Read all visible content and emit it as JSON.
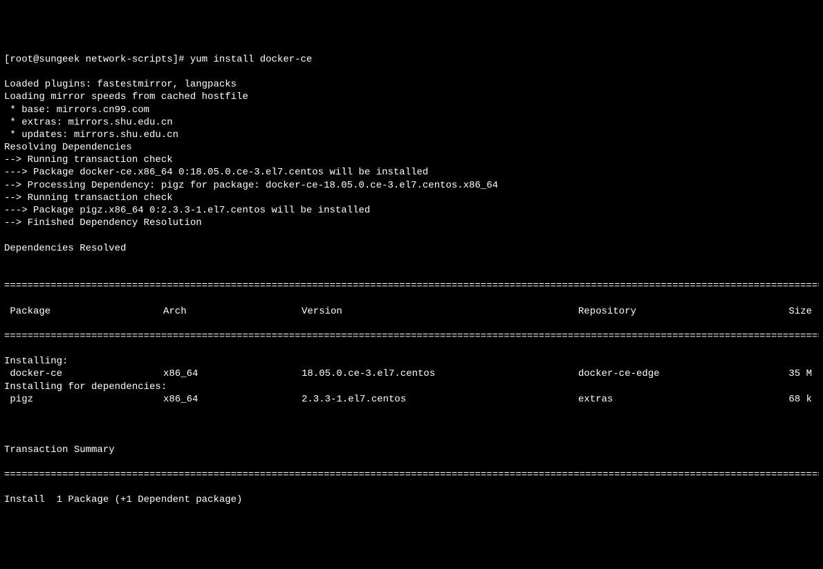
{
  "prompt": {
    "user": "root",
    "host": "sungeek",
    "cwd": "network-scripts",
    "hash": "#",
    "command": "yum install docker-ce"
  },
  "pre_lines": [
    "Loaded plugins: fastestmirror, langpacks",
    "Loading mirror speeds from cached hostfile",
    " * base: mirrors.cn99.com",
    " * extras: mirrors.shu.edu.cn",
    " * updates: mirrors.shu.edu.cn",
    "Resolving Dependencies",
    "--> Running transaction check",
    "---> Package docker-ce.x86_64 0:18.05.0.ce-3.el7.centos will be installed",
    "--> Processing Dependency: pigz for package: docker-ce-18.05.0.ce-3.el7.centos.x86_64",
    "--> Running transaction check",
    "---> Package pigz.x86_64 0:2.3.3-1.el7.centos will be installed",
    "--> Finished Dependency Resolution",
    "",
    "Dependencies Resolved",
    ""
  ],
  "sep": "==============================================================================================================================================",
  "headers": {
    "pkg": " Package",
    "arch": "Arch",
    "ver": "Version",
    "repo": "Repository",
    "size": "Size"
  },
  "sections": [
    {
      "title": "Installing:",
      "rows": [
        {
          "pkg": " docker-ce",
          "arch": "x86_64",
          "ver": "18.05.0.ce-3.el7.centos",
          "repo": "docker-ce-edge",
          "size": "35 M"
        }
      ]
    },
    {
      "title": "Installing for dependencies:",
      "rows": [
        {
          "pkg": " pigz",
          "arch": "x86_64",
          "ver": "2.3.3-1.el7.centos",
          "repo": "extras",
          "size": "68 k"
        }
      ]
    }
  ],
  "txn_summary_label": "Transaction Summary",
  "install_line": "Install  1 Package (+1 Dependent package)"
}
